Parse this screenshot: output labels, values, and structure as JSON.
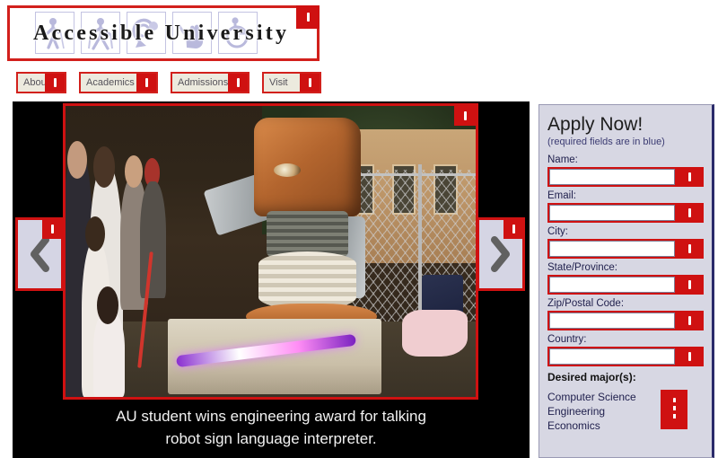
{
  "site": {
    "logo_text": "Accessible University",
    "logo_icons": [
      "blind-cane-icon",
      "mobility-crutches-icon",
      "hearing-ear-icon",
      "sign-language-hand-icon",
      "wheelchair-icon"
    ]
  },
  "nav": {
    "items": [
      {
        "label": "About"
      },
      {
        "label": "Academics"
      },
      {
        "label": "Admissions"
      },
      {
        "label": "Visit"
      }
    ]
  },
  "carousel": {
    "prev_label": "Previous slide",
    "next_label": "Next slide",
    "caption_line1": "AU student wins engineering award for talking",
    "caption_line2": "robot sign language interpreter.",
    "image_alt": "Crowd of people viewing a carved wooden robot sculpture at an outdoor maker fair"
  },
  "sidebar": {
    "title": "Apply Now!",
    "subtitle": "(required fields are in blue)",
    "fields": [
      {
        "label": "Name:",
        "value": "",
        "placeholder": ""
      },
      {
        "label": "Email:",
        "value": "",
        "placeholder": ""
      },
      {
        "label": "City:",
        "value": "",
        "placeholder": ""
      },
      {
        "label": "State/Province:",
        "value": "",
        "placeholder": ""
      },
      {
        "label": "Zip/Postal Code:",
        "value": "",
        "placeholder": ""
      },
      {
        "label": "Country:",
        "value": "",
        "placeholder": ""
      }
    ],
    "major_label": "Desired major(s):",
    "majors": [
      "Computer Science",
      "Engineering",
      "Economics"
    ]
  },
  "annotations": {
    "glyph": "|",
    "color": "#cf1111"
  }
}
